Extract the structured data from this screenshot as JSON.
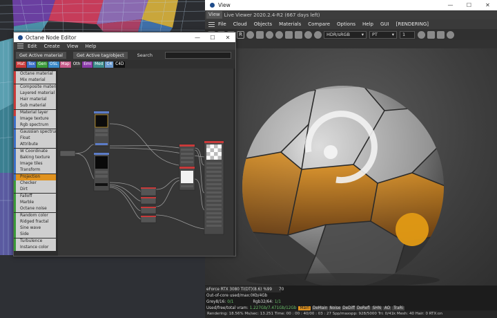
{
  "viewer": {
    "title": "View",
    "tab_label": "View",
    "version_text": "Live Viewer 2020.2.4-R2 (667 days left)",
    "menu": [
      "File",
      "Cloud",
      "Objects",
      "Materials",
      "Compare",
      "Options",
      "Help",
      "GUI",
      "[RENDERING]"
    ],
    "colorspace_select": "HDR/sRGB",
    "kernel_select": "PT",
    "pass_select": "1",
    "stats": {
      "device_name": "eForce RTX 3080 Ti(DT)(8.6)",
      "device_pct": "%99",
      "device_temp": "70",
      "out_of_core": "Out-of-core used/max:0Kb/4Gb",
      "grey_label": "Grey8/16:",
      "grey_value": "0/1",
      "rgb_label": "Rgb32/64:",
      "rgb_value": "1/1",
      "vram_label": "Used/free/total vram:",
      "vram_value": "1.227Gb/7.471Gb/12Gb"
    },
    "render_buttons": [
      "Main",
      "DeMain",
      "Noise",
      "DeDiff",
      "DeRefl",
      "SHN",
      "AO",
      "TraRi"
    ],
    "status_line": "Rendering: 18.56%  Ms/sec: 13.251   Time: 00 : 00 : 40/00 : 03 : 27   Spp/maxspp: 928/5000  Tri: 0/41k   Mesh: 40   Hair: 0   RTX:on"
  },
  "node_editor": {
    "title": "Octane Node Editor",
    "menu": [
      "Edit",
      "Create",
      "View",
      "Help"
    ],
    "buttons": {
      "get_active_material": "Get Active material",
      "get_active_tag": "Get Active tag/object",
      "search_label": "Search"
    },
    "categories": [
      {
        "label": "Mat",
        "color": "#c83a3a"
      },
      {
        "label": "Tex",
        "color": "#3a6fc8"
      },
      {
        "label": "Gen",
        "color": "#3a9a3a"
      },
      {
        "label": "OSL",
        "color": "#3a8ac8"
      },
      {
        "label": "Map",
        "color": "#c85a8a"
      },
      {
        "label": "Oth",
        "color": "#3a3a3a"
      },
      {
        "label": "Emi",
        "color": "#8a3aa8"
      },
      {
        "label": "Med",
        "color": "#3a8a8a"
      },
      {
        "label": "C4",
        "color": "#6a9ad0"
      },
      {
        "label": "C4D",
        "color": "#111111"
      }
    ],
    "nodes": [
      {
        "label": "Octane material",
        "color": "#c83a3a"
      },
      {
        "label": "Mix material",
        "color": "#c83a3a"
      },
      {
        "label": "Composite material",
        "color": "#c83a3a"
      },
      {
        "label": "Layered material",
        "color": "#c83a3a"
      },
      {
        "label": "Hair material",
        "color": "#c83a3a"
      },
      {
        "label": "Sub material",
        "color": "#c83a3a"
      },
      {
        "label": "Material layer",
        "color": "#c83a3a"
      },
      {
        "label": "Image texture",
        "color": "#3a6fc8"
      },
      {
        "label": "Rgb spectrum",
        "color": "#3a6fc8"
      },
      {
        "label": "Gaussian spectrum",
        "color": "#3a6fc8"
      },
      {
        "label": "Float",
        "color": "#3a6fc8"
      },
      {
        "label": "Attribute",
        "color": "#3a6fc8"
      },
      {
        "label": "W Coordinate",
        "color": "#3a6fc8"
      },
      {
        "label": "Baking texture",
        "color": "#3a6fc8"
      },
      {
        "label": "Image tiles",
        "color": "#3a6fc8"
      },
      {
        "label": "Transform",
        "color": "#3a6fc8"
      },
      {
        "label": "Projection",
        "color": "#3a6fc8"
      },
      {
        "label": "Checker",
        "color": "#3a9a3a"
      },
      {
        "label": "Dirt",
        "color": "#3a9a3a"
      },
      {
        "label": "Falloff",
        "color": "#3a9a3a"
      },
      {
        "label": "Marble",
        "color": "#3a9a3a"
      },
      {
        "label": "Octane noise",
        "color": "#3a9a3a"
      },
      {
        "label": "Random color",
        "color": "#3a9a3a"
      },
      {
        "label": "Ridged fractal",
        "color": "#3a9a3a"
      },
      {
        "label": "Sine wave",
        "color": "#3a9a3a"
      },
      {
        "label": "Side",
        "color": "#3a9a3a"
      },
      {
        "label": "Turbulence",
        "color": "#3a9a3a"
      },
      {
        "label": "Instance color",
        "color": "#3a9a3a"
      }
    ],
    "active_node": "Projection"
  }
}
